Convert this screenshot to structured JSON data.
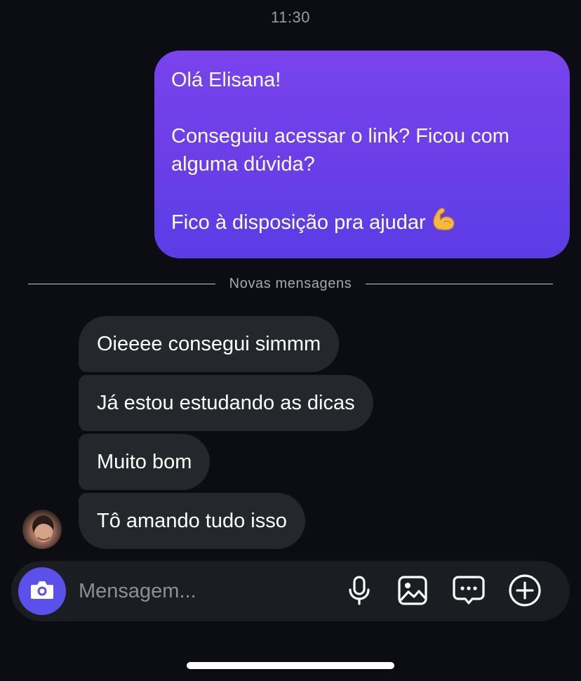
{
  "chat": {
    "timestamp": "11:30",
    "sent_message": {
      "line1": "Olá Elisana!",
      "line2": "Conseguiu acessar o link? Ficou com alguma dúvida?",
      "line3": "Fico à disposição pra ajudar",
      "emoji": "flexed-biceps"
    },
    "divider_label": "Novas mensagens",
    "received_messages": [
      {
        "text": "Oieeee consegui simmm"
      },
      {
        "text": "Já estou estudando as dicas"
      },
      {
        "text": "Muito bom"
      },
      {
        "text": "Tô amando tudo isso"
      }
    ]
  },
  "composer": {
    "placeholder": "Mensagem...",
    "icons": [
      "camera-icon",
      "microphone-icon",
      "image-icon",
      "sticker-icon",
      "plus-circle-icon"
    ]
  },
  "colors": {
    "background": "#0c0d12",
    "sent_bubble": "#6a3ee8",
    "received_bubble": "#26272c",
    "camera_button": "#5b51ea"
  }
}
